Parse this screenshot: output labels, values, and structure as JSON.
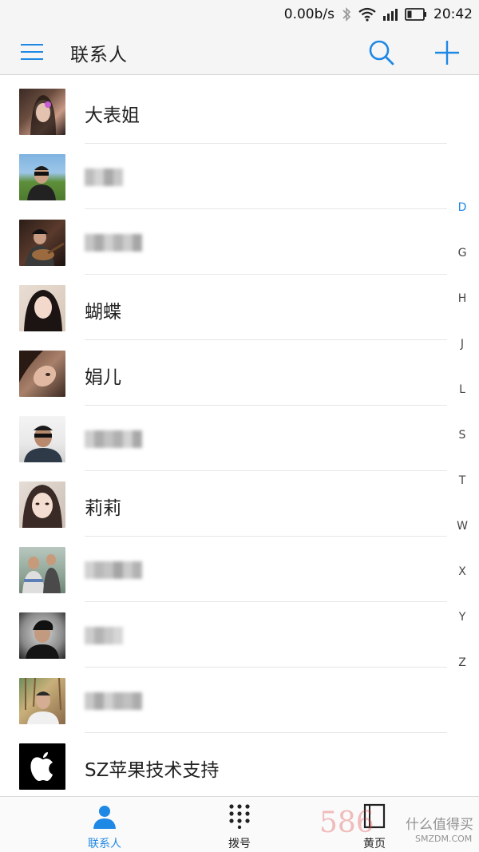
{
  "status_bar": {
    "speed": "0.00b/s",
    "time": "20:42"
  },
  "app_bar": {
    "title": "联系人"
  },
  "contacts": [
    {
      "name": "大表姐"
    },
    {
      "name": ""
    },
    {
      "name": ""
    },
    {
      "name": "蝴蝶"
    },
    {
      "name": "娟儿"
    },
    {
      "name": ""
    },
    {
      "name": "莉莉"
    },
    {
      "name": ""
    },
    {
      "name": ""
    },
    {
      "name": ""
    },
    {
      "name": "SZ苹果技术支持"
    }
  ],
  "index_letters": [
    "D",
    "G",
    "H",
    "J",
    "L",
    "S",
    "T",
    "W",
    "X",
    "Y",
    "Z"
  ],
  "bottom_nav": {
    "contacts_label": "联系人",
    "dialer_label": "拨号",
    "yellowpage_label": "黄页"
  },
  "watermark": {
    "number": "586",
    "site_name": "什么值得买",
    "site_url": "SMZDM.COM"
  },
  "colors": {
    "accent": "#1e88e5",
    "background": "#ffffff",
    "bar": "#f5f5f5"
  }
}
